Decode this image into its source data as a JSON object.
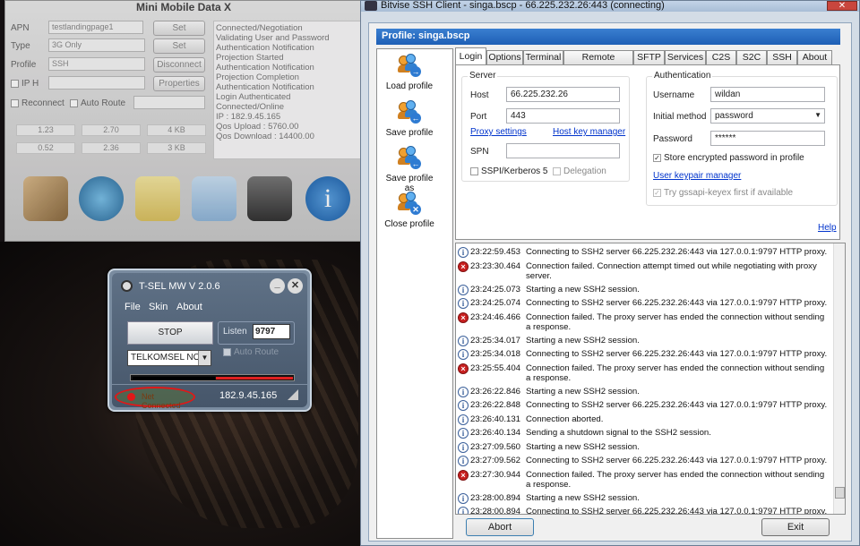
{
  "mmd": {
    "title": "Mini Mobile Data X",
    "apn_label": "APN",
    "apn_value": "testlandingpage1",
    "type_label": "Type",
    "type_value": "3G Only",
    "profile_label": "Profile",
    "profile_value": "SSH",
    "iph_label": "IP H",
    "reconnect_label": "Reconnect",
    "autoroute_label": "Auto Route",
    "set1": "Set",
    "set2": "Set",
    "disconnect": "Disconnect",
    "properties": "Properties",
    "stats": [
      "1.23",
      "2.70",
      "4 KB",
      "0.52",
      "2.36",
      "3 KB"
    ],
    "log": [
      "Connected/Negotiation",
      "Validating User and Password",
      "Authentication Notification",
      "Projection Started",
      "Authentication Notification",
      "Projection Completion",
      "Authentication Notification",
      "Login Authenticated",
      "Connected/Online",
      "IP : 182.9.45.165",
      "Qos Upload : 5760.00",
      "Qos Download : 14400.00"
    ]
  },
  "tsel": {
    "title": "T-SEL MW V 2.0.6",
    "menu_file": "File",
    "menu_skin": "Skin",
    "menu_about": "About",
    "stop": "STOP",
    "listen_label": "Listen",
    "listen_value": "9797",
    "autoroute": "Auto Route",
    "operator": "TELKOMSEL NO AV",
    "status": "Net Connected",
    "ip": "182.9.45.165"
  },
  "bv": {
    "title": "Bitvise SSH Client - singa.bscp - 66.225.232.26:443 (connecting)",
    "profile": "Profile: singa.bscp",
    "sidebar": [
      "Load profile",
      "Save profile",
      "Save profile as",
      "Close profile"
    ],
    "tabs": [
      "Login",
      "Options",
      "Terminal",
      "Remote Desktop",
      "SFTP",
      "Services",
      "C2S",
      "S2C",
      "SSH",
      "About"
    ],
    "server_group": "Server",
    "host_label": "Host",
    "host_value": "66.225.232.26",
    "port_label": "Port",
    "port_value": "443",
    "proxy_link": "Proxy settings",
    "hostkey_link": "Host key manager",
    "spn_label": "SPN",
    "sspi_label": "SSPI/Kerberos 5",
    "delegation_label": "Delegation",
    "auth_group": "Authentication",
    "username_label": "Username",
    "username_value": "wildan",
    "method_label": "Initial method",
    "method_value": "password",
    "password_label": "Password",
    "password_value": "******",
    "store_label": "Store encrypted password in profile",
    "keypair_link": "User keypair manager",
    "gssapi_label": "Try gssapi-keyex first if available",
    "help": "Help",
    "abort": "Abort",
    "exit": "Exit",
    "log": [
      {
        "t": "i",
        "time": "23:22:59.453",
        "msg": "Connecting to SSH2 server 66.225.232.26:443 via 127.0.0.1:9797 HTTP proxy."
      },
      {
        "t": "x",
        "time": "23:23:30.464",
        "msg": "Connection failed. Connection attempt timed out while negotiating with proxy server."
      },
      {
        "t": "i",
        "time": "23:24:25.073",
        "msg": "Starting a new SSH2 session."
      },
      {
        "t": "i",
        "time": "23:24:25.074",
        "msg": "Connecting to SSH2 server 66.225.232.26:443 via 127.0.0.1:9797 HTTP proxy."
      },
      {
        "t": "x",
        "time": "23:24:46.466",
        "msg": "Connection failed. The proxy server has ended the connection without sending a response."
      },
      {
        "t": "i",
        "time": "23:25:34.017",
        "msg": "Starting a new SSH2 session."
      },
      {
        "t": "i",
        "time": "23:25:34.018",
        "msg": "Connecting to SSH2 server 66.225.232.26:443 via 127.0.0.1:9797 HTTP proxy."
      },
      {
        "t": "x",
        "time": "23:25:55.404",
        "msg": "Connection failed. The proxy server has ended the connection without sending a response."
      },
      {
        "t": "i",
        "time": "23:26:22.846",
        "msg": "Starting a new SSH2 session."
      },
      {
        "t": "i",
        "time": "23:26:22.848",
        "msg": "Connecting to SSH2 server 66.225.232.26:443 via 127.0.0.1:9797 HTTP proxy."
      },
      {
        "t": "i",
        "time": "23:26:40.131",
        "msg": "Connection aborted."
      },
      {
        "t": "i",
        "time": "23:26:40.134",
        "msg": "Sending a shutdown signal to the SSH2 session."
      },
      {
        "t": "i",
        "time": "23:27:09.560",
        "msg": "Starting a new SSH2 session."
      },
      {
        "t": "i",
        "time": "23:27:09.562",
        "msg": "Connecting to SSH2 server 66.225.232.26:443 via 127.0.0.1:9797 HTTP proxy."
      },
      {
        "t": "x",
        "time": "23:27:30.944",
        "msg": "Connection failed. The proxy server has ended the connection without sending a response."
      },
      {
        "t": "i",
        "time": "23:28:00.894",
        "msg": "Starting a new SSH2 session."
      },
      {
        "t": "i",
        "time": "23:28:00.894",
        "msg": "Connecting to SSH2 server 66.225.232.26:443 via 127.0.0.1:9797 HTTP proxy."
      }
    ]
  }
}
